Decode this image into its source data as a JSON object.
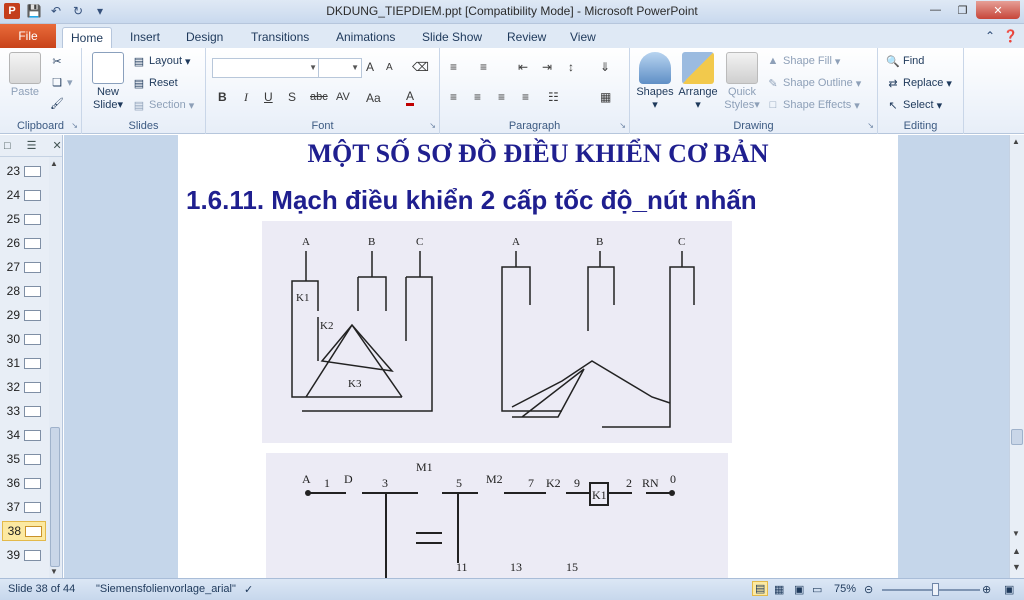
{
  "window": {
    "title": "DKDUNG_TIEPDIEM.ppt [Compatibility Mode] - Microsoft PowerPoint",
    "app_icon": "P"
  },
  "tabs": [
    "File",
    "Home",
    "Insert",
    "Design",
    "Transitions",
    "Animations",
    "Slide Show",
    "Review",
    "View"
  ],
  "ribbon": {
    "clipboard": {
      "label": "Clipboard",
      "paste": "Paste"
    },
    "slides": {
      "label": "Slides",
      "new_slide_1": "New",
      "new_slide_2": "Slide",
      "layout": "Layout",
      "reset": "Reset",
      "section": "Section"
    },
    "font": {
      "label": "Font",
      "bold": "B",
      "italic": "I",
      "underline": "U",
      "shadow": "S",
      "strike": "abc",
      "spacing": "AV",
      "case": "Aa",
      "color": "A",
      "grow": "A",
      "shrink": "A"
    },
    "paragraph": {
      "label": "Paragraph"
    },
    "drawing": {
      "label": "Drawing",
      "shapes": "Shapes",
      "arrange": "Arrange",
      "quick_styles_1": "Quick",
      "quick_styles_2": "Styles",
      "shape_fill": "Shape Fill",
      "shape_outline": "Shape Outline",
      "shape_effects": "Shape Effects"
    },
    "editing": {
      "label": "Editing",
      "find": "Find",
      "replace": "Replace",
      "select": "Select"
    }
  },
  "slides_panel": {
    "items": [
      {
        "num": "23",
        "current": false
      },
      {
        "num": "24",
        "current": false
      },
      {
        "num": "25",
        "current": false
      },
      {
        "num": "26",
        "current": false
      },
      {
        "num": "27",
        "current": false
      },
      {
        "num": "28",
        "current": false
      },
      {
        "num": "29",
        "current": false
      },
      {
        "num": "30",
        "current": false
      },
      {
        "num": "31",
        "current": false
      },
      {
        "num": "32",
        "current": false
      },
      {
        "num": "33",
        "current": false
      },
      {
        "num": "34",
        "current": false
      },
      {
        "num": "35",
        "current": false
      },
      {
        "num": "36",
        "current": false
      },
      {
        "num": "37",
        "current": false
      },
      {
        "num": "38",
        "current": true
      },
      {
        "num": "39",
        "current": false
      }
    ]
  },
  "slide": {
    "title": "MỘT SỐ SƠ ĐỒ ĐIỀU KHIỂN CƠ BẢN",
    "heading": "1.6.11. Mạch điều khiển 2 cấp tốc độ_nút nhấn",
    "diagram1_labels": [
      "A",
      "B",
      "C",
      "K1",
      "K2",
      "K3"
    ],
    "diagram2_labels": [
      "A",
      "1",
      "D",
      "3",
      "M1",
      "5",
      "M2",
      "7",
      "K2",
      "9",
      "K1",
      "2",
      "RN",
      "0",
      "11",
      "13",
      "15"
    ]
  },
  "status": {
    "slide_info": "Slide 38 of 44",
    "theme": "\"Siemensfolienvorlage_arial\"",
    "zoom": "75%"
  }
}
